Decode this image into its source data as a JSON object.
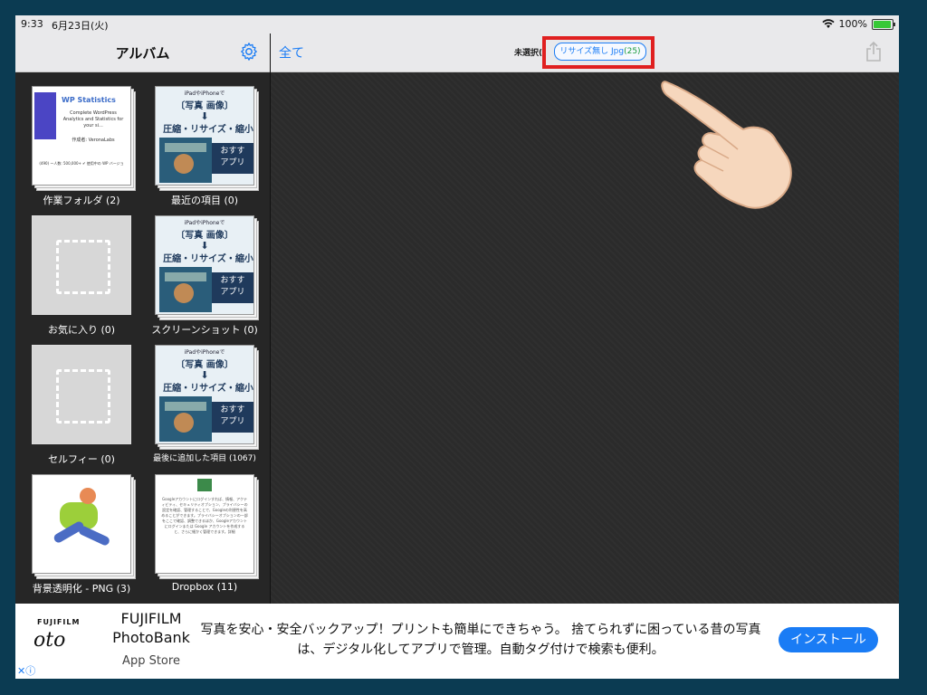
{
  "status_bar": {
    "time": "9:33",
    "date": "6月23日(火)",
    "battery": "100%"
  },
  "sidebar": {
    "title": "アルバム",
    "albums": [
      {
        "label": "作業フォルダ (2)"
      },
      {
        "label": "最近の項目 (0)"
      },
      {
        "label": "お気に入り (0)"
      },
      {
        "label": "スクリーンショット (0)"
      },
      {
        "label": "セルフィー (0)"
      },
      {
        "label": "最後に追加した項目 (1067)"
      },
      {
        "label": "背景透明化 - PNG (3)"
      },
      {
        "label": "Dropbox (11)"
      }
    ],
    "wp_thumb": {
      "title": "WP Statistics",
      "desc": "Complete WordPress Analytics and Statistics for your si...",
      "author": "作成者: VeronaLabs",
      "footer": "(490)  ー人数: 500,000+  ✔ 使用中の WP バージョ"
    },
    "promo_thumb": {
      "line1": "iPadやiPhoneで",
      "line2": "〔写真 画像〕",
      "arrow": "⬇",
      "line3": "圧縮・リサイズ・縮小",
      "box": "おすす アプリ"
    },
    "dropbox_thumb": {
      "text": "Googleアカウントにログインすれば、情報、アクティビティ、セキュリティオプション、プライバシーの設定を確認、管理することで、Googleの利便性を高めることができます。プライバシーオプションの一部をここで確認、調整できるほか、Googleアカウントにログインまたは Google アカウントを作成すると、さらに細かく管理できます。詳細"
    }
  },
  "toolbar": {
    "all_label": "全て",
    "unselected_label": "未選択(",
    "resize_label": "リサイズ無し Jpg",
    "resize_count": "(25)"
  },
  "ad": {
    "brand": "FUJIFILM",
    "logo": "oto",
    "app_name_1": "FUJIFILM",
    "app_name_2": "PhotoBank",
    "store": "App Store",
    "text": "写真を安心・安全バックアップ！プリントも簡単にできちゃう。 捨てられずに困っている昔の写真は、デジタル化してアプリで管理。自動タグ付けで検索も便利。",
    "install_label": "インストール",
    "adchoice": "✕ⓘ"
  },
  "icons": {
    "gear": "gear-icon",
    "share": "share-icon",
    "wifi": "wifi-icon",
    "battery": "battery-icon",
    "hand": "pointing-hand-icon"
  },
  "colors": {
    "accent": "#1a7cf5",
    "highlight": "#e02020",
    "canvas": "#2b2b2b",
    "frame": "#0b3b52"
  }
}
